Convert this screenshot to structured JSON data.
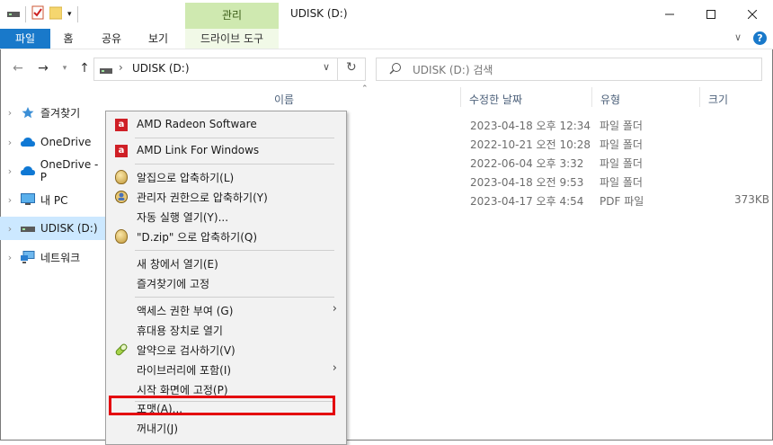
{
  "window": {
    "title": "UDISK (D:)",
    "manage_tab": "관리"
  },
  "ribbon": {
    "tabs": [
      "파일",
      "홈",
      "공유",
      "보기",
      "드라이브 도구"
    ]
  },
  "address": {
    "path": "UDISK (D:)",
    "search_placeholder": "UDISK (D:) 검색"
  },
  "nav": [
    {
      "label": "즐겨찾기",
      "icon": "star-icon"
    },
    {
      "label": "OneDrive",
      "icon": "cloud-icon"
    },
    {
      "label": "OneDrive - P",
      "icon": "cloud-icon"
    },
    {
      "label": "내 PC",
      "icon": "pc-icon"
    },
    {
      "label": "UDISK (D:)",
      "icon": "drive-icon",
      "selected": true
    },
    {
      "label": "네트워크",
      "icon": "network-icon"
    }
  ],
  "columns": {
    "name": "이름",
    "modified": "수정한 날짜",
    "type": "유형",
    "size": "크기"
  },
  "rows": [
    {
      "date": "2023-04-18 오후 12:34",
      "type": "파일 폴더",
      "size": ""
    },
    {
      "date": "2022-10-21 오전 10:28",
      "type": "파일 폴더",
      "size": ""
    },
    {
      "date": "2022-06-04 오후 3:32",
      "type": "파일 폴더",
      "size": ""
    },
    {
      "date": "2023-04-18 오전 9:53",
      "type": "파일 폴더",
      "size": ""
    },
    {
      "date": "2023-04-17 오후 4:54",
      "type": "PDF 파일",
      "size": "373KB"
    }
  ],
  "menu": {
    "amd_radeon": "AMD Radeon Software",
    "amd_link": "AMD Link For Windows",
    "alzip_compress": "알집으로 압축하기(L)",
    "admin_compress": "관리자 권한으로 압축하기(Y)",
    "autoplay": "자동 실행 열기(Y)...",
    "dzip_compress": "\"D.zip\" 으로 압축하기(Q)",
    "open_new_window": "새 창에서 열기(E)",
    "pin_quick": "즐겨찾기에 고정",
    "give_access": "액세스 권한 부여 (G)",
    "open_portable": "휴대용 장치로 열기",
    "alyac_scan": "알약으로 검사하기(V)",
    "include_library": "라이브러리에 포함(I)",
    "pin_start": "시작 화면에 고정(P)",
    "format": "포맷(A)...",
    "eject": "꺼내기(J)"
  },
  "colors": {
    "accent": "#1979ca",
    "manage": "#cfe9b0",
    "highlight": "#e4000f",
    "selected": "#cce8ff"
  }
}
